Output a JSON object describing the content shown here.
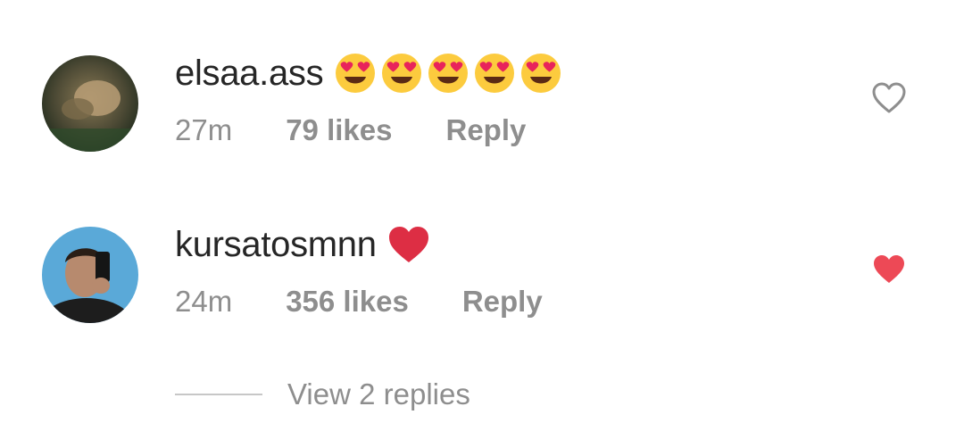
{
  "comments": [
    {
      "username": "elsaa.ass",
      "emoji": [
        "heart-eyes",
        "heart-eyes",
        "heart-eyes",
        "heart-eyes",
        "heart-eyes"
      ],
      "time": "27m",
      "likes": "79 likes",
      "reply": "Reply",
      "liked": false
    },
    {
      "username": "kursatosmnn",
      "emoji": [
        "red-heart"
      ],
      "time": "24m",
      "likes": "356 likes",
      "reply": "Reply",
      "liked": true
    }
  ],
  "view_replies": "View 2 replies",
  "colors": {
    "text": "#262626",
    "meta": "#8e8e8e",
    "liked_heart": "#ed4956",
    "unliked_heart": "#8e8e8e",
    "divider": "#c7c7c7"
  }
}
